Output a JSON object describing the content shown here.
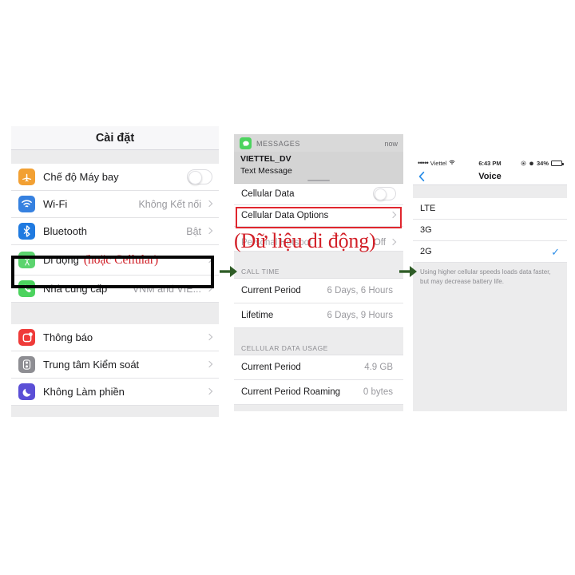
{
  "colors": {
    "red_annotation": "#cf1d25",
    "arrow_green": "#2f5d27",
    "highlight_black": "#050505",
    "redbox": "#e0262e",
    "accent_blue": "#2e8fe8"
  },
  "left_panel": {
    "nav_title": "Cài đặt",
    "group_1": [
      {
        "icon": "airplane-icon",
        "label": "Chế độ Máy bay",
        "control": "toggle",
        "toggle_on": false,
        "value": ""
      },
      {
        "icon": "wifi-icon",
        "label": "Wi-Fi",
        "control": "chevron",
        "value": "Không Kết nối"
      },
      {
        "icon": "bluetooth-icon",
        "label": "Bluetooth",
        "control": "chevron",
        "value": "Bật"
      },
      {
        "icon": "cellular-icon",
        "label": "Di động",
        "annotation": "(hoặc Cellular)",
        "control": "chevron",
        "value": ""
      },
      {
        "icon": "phone-icon",
        "label": "Nhà cung cấp",
        "control": "chevron",
        "value": "VNM and VIE..."
      }
    ],
    "group_2": [
      {
        "icon": "notifications-icon",
        "label": "Thông báo",
        "control": "chevron",
        "value": ""
      },
      {
        "icon": "control-center-icon",
        "label": "Trung tâm Kiểm soát",
        "control": "chevron",
        "value": ""
      },
      {
        "icon": "do-not-disturb-icon",
        "label": "Không Làm phiền",
        "control": "chevron",
        "value": ""
      }
    ]
  },
  "mid_panel": {
    "notification": {
      "app_name": "MESSAGES",
      "time": "now",
      "title": "VIETTEL_DV",
      "subtitle": "Text Message"
    },
    "rows": [
      {
        "label": "Cellular Data",
        "control": "toggle",
        "toggle_on": false,
        "value": ""
      },
      {
        "label": "Cellular Data Options",
        "control": "chevron",
        "value": "",
        "highlighted": true
      },
      {
        "label": "Personal Hotspot",
        "control": "chevron",
        "value": "Off",
        "dimmed": true
      }
    ],
    "annotation": "(Dữ liệu di động)",
    "section_call_time": {
      "header": "CALL TIME",
      "rows": [
        {
          "label": "Current Period",
          "value": "6 Days, 6 Hours"
        },
        {
          "label": "Lifetime",
          "value": "6 Days, 9 Hours"
        }
      ]
    },
    "section_data_usage": {
      "header": "CELLULAR DATA USAGE",
      "rows": [
        {
          "label": "Current Period",
          "value": "4.9 GB"
        },
        {
          "label": "Current Period Roaming",
          "value": "0 bytes"
        }
      ]
    }
  },
  "right_panel": {
    "status_bar": {
      "signal_dots": "•••••",
      "carrier": "Viettel",
      "wifi_icon": "wifi-icon",
      "time": "6:43 PM",
      "battery_percent": "34%",
      "battery_level": 34
    },
    "nav": {
      "back_icon": "back-chevron-icon",
      "title": "Voice"
    },
    "options": [
      {
        "label": "LTE",
        "selected": false
      },
      {
        "label": "3G",
        "selected": false
      },
      {
        "label": "2G",
        "selected": true
      }
    ],
    "checkmark": "✓",
    "footer": "Using higher cellular speeds loads data faster, but may decrease battery life."
  },
  "arrows": {
    "arrow_1_name": "step-arrow-1",
    "arrow_2_name": "step-arrow-2"
  }
}
